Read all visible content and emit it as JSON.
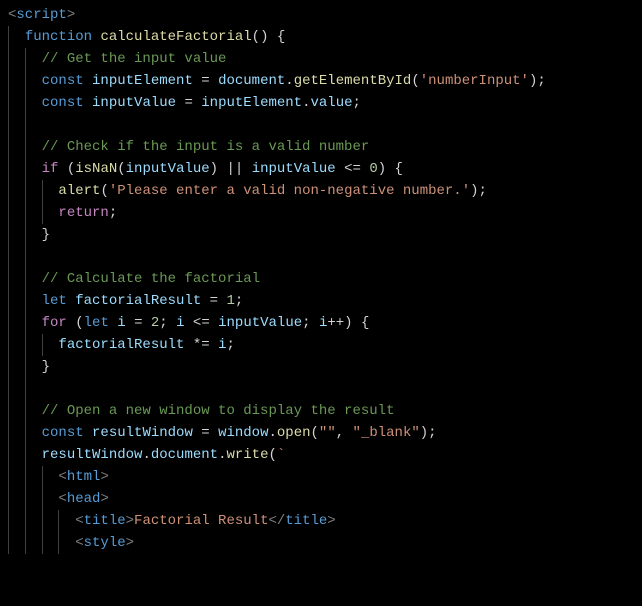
{
  "code": {
    "lines": [
      {
        "indent": 0,
        "guides": 0,
        "tokens": [
          {
            "c": "tag",
            "t": "<"
          },
          {
            "c": "elem",
            "t": "script"
          },
          {
            "c": "tag",
            "t": ">"
          }
        ]
      },
      {
        "indent": 1,
        "guides": 1,
        "tokens": [
          {
            "c": "kw",
            "t": "function"
          },
          {
            "c": "pun",
            "t": " "
          },
          {
            "c": "fn",
            "t": "calculateFactorial"
          },
          {
            "c": "pun",
            "t": "() {"
          }
        ]
      },
      {
        "indent": 2,
        "guides": 2,
        "tokens": [
          {
            "c": "cmt",
            "t": "// Get the input value"
          }
        ]
      },
      {
        "indent": 2,
        "guides": 2,
        "tokens": [
          {
            "c": "kw",
            "t": "const"
          },
          {
            "c": "pun",
            "t": " "
          },
          {
            "c": "var",
            "t": "inputElement"
          },
          {
            "c": "pun",
            "t": " = "
          },
          {
            "c": "var",
            "t": "document"
          },
          {
            "c": "pun",
            "t": "."
          },
          {
            "c": "fn",
            "t": "getElementById"
          },
          {
            "c": "pun",
            "t": "("
          },
          {
            "c": "str",
            "t": "'numberInput'"
          },
          {
            "c": "pun",
            "t": ");"
          }
        ]
      },
      {
        "indent": 2,
        "guides": 2,
        "tokens": [
          {
            "c": "kw",
            "t": "const"
          },
          {
            "c": "pun",
            "t": " "
          },
          {
            "c": "var",
            "t": "inputValue"
          },
          {
            "c": "pun",
            "t": " = "
          },
          {
            "c": "var",
            "t": "inputElement"
          },
          {
            "c": "pun",
            "t": "."
          },
          {
            "c": "var",
            "t": "value"
          },
          {
            "c": "pun",
            "t": ";"
          }
        ]
      },
      {
        "indent": 0,
        "guides": 2,
        "tokens": []
      },
      {
        "indent": 2,
        "guides": 2,
        "tokens": [
          {
            "c": "cmt",
            "t": "// Check if the input is a valid number"
          }
        ]
      },
      {
        "indent": 2,
        "guides": 2,
        "tokens": [
          {
            "c": "ctrl",
            "t": "if"
          },
          {
            "c": "pun",
            "t": " ("
          },
          {
            "c": "fn",
            "t": "isNaN"
          },
          {
            "c": "pun",
            "t": "("
          },
          {
            "c": "var",
            "t": "inputValue"
          },
          {
            "c": "pun",
            "t": ") || "
          },
          {
            "c": "var",
            "t": "inputValue"
          },
          {
            "c": "pun",
            "t": " <= "
          },
          {
            "c": "num",
            "t": "0"
          },
          {
            "c": "pun",
            "t": ") {"
          }
        ]
      },
      {
        "indent": 3,
        "guides": 3,
        "tokens": [
          {
            "c": "fn",
            "t": "alert"
          },
          {
            "c": "pun",
            "t": "("
          },
          {
            "c": "str",
            "t": "'Please enter a valid non-negative number.'"
          },
          {
            "c": "pun",
            "t": ");"
          }
        ]
      },
      {
        "indent": 3,
        "guides": 3,
        "tokens": [
          {
            "c": "ctrl",
            "t": "return"
          },
          {
            "c": "pun",
            "t": ";"
          }
        ]
      },
      {
        "indent": 2,
        "guides": 2,
        "tokens": [
          {
            "c": "pun",
            "t": "}"
          }
        ]
      },
      {
        "indent": 0,
        "guides": 2,
        "tokens": []
      },
      {
        "indent": 2,
        "guides": 2,
        "tokens": [
          {
            "c": "cmt",
            "t": "// Calculate the factorial"
          }
        ]
      },
      {
        "indent": 2,
        "guides": 2,
        "tokens": [
          {
            "c": "kw",
            "t": "let"
          },
          {
            "c": "pun",
            "t": " "
          },
          {
            "c": "var",
            "t": "factorialResult"
          },
          {
            "c": "pun",
            "t": " = "
          },
          {
            "c": "num",
            "t": "1"
          },
          {
            "c": "pun",
            "t": ";"
          }
        ]
      },
      {
        "indent": 2,
        "guides": 2,
        "tokens": [
          {
            "c": "ctrl",
            "t": "for"
          },
          {
            "c": "pun",
            "t": " ("
          },
          {
            "c": "kw",
            "t": "let"
          },
          {
            "c": "pun",
            "t": " "
          },
          {
            "c": "var",
            "t": "i"
          },
          {
            "c": "pun",
            "t": " = "
          },
          {
            "c": "num",
            "t": "2"
          },
          {
            "c": "pun",
            "t": "; "
          },
          {
            "c": "var",
            "t": "i"
          },
          {
            "c": "pun",
            "t": " <= "
          },
          {
            "c": "var",
            "t": "inputValue"
          },
          {
            "c": "pun",
            "t": "; "
          },
          {
            "c": "var",
            "t": "i"
          },
          {
            "c": "pun",
            "t": "++) {"
          }
        ]
      },
      {
        "indent": 3,
        "guides": 3,
        "tokens": [
          {
            "c": "var",
            "t": "factorialResult"
          },
          {
            "c": "pun",
            "t": " *= "
          },
          {
            "c": "var",
            "t": "i"
          },
          {
            "c": "pun",
            "t": ";"
          }
        ]
      },
      {
        "indent": 2,
        "guides": 2,
        "tokens": [
          {
            "c": "pun",
            "t": "}"
          }
        ]
      },
      {
        "indent": 0,
        "guides": 2,
        "tokens": []
      },
      {
        "indent": 2,
        "guides": 2,
        "tokens": [
          {
            "c": "cmt",
            "t": "// Open a new window to display the result"
          }
        ]
      },
      {
        "indent": 2,
        "guides": 2,
        "tokens": [
          {
            "c": "kw",
            "t": "const"
          },
          {
            "c": "pun",
            "t": " "
          },
          {
            "c": "var",
            "t": "resultWindow"
          },
          {
            "c": "pun",
            "t": " = "
          },
          {
            "c": "var",
            "t": "window"
          },
          {
            "c": "pun",
            "t": "."
          },
          {
            "c": "fn",
            "t": "open"
          },
          {
            "c": "pun",
            "t": "("
          },
          {
            "c": "str",
            "t": "\"\""
          },
          {
            "c": "pun",
            "t": ", "
          },
          {
            "c": "str",
            "t": "\"_blank\""
          },
          {
            "c": "pun",
            "t": ");"
          }
        ]
      },
      {
        "indent": 2,
        "guides": 2,
        "tokens": [
          {
            "c": "var",
            "t": "resultWindow"
          },
          {
            "c": "pun",
            "t": "."
          },
          {
            "c": "var",
            "t": "document"
          },
          {
            "c": "pun",
            "t": "."
          },
          {
            "c": "fn",
            "t": "write"
          },
          {
            "c": "pun",
            "t": "("
          },
          {
            "c": "str",
            "t": "`"
          }
        ]
      },
      {
        "indent": 3,
        "guides": 3,
        "tokens": [
          {
            "c": "tag",
            "t": "<"
          },
          {
            "c": "elem",
            "t": "html"
          },
          {
            "c": "tag",
            "t": ">"
          }
        ]
      },
      {
        "indent": 3,
        "guides": 3,
        "tokens": [
          {
            "c": "tag",
            "t": "<"
          },
          {
            "c": "elem",
            "t": "head"
          },
          {
            "c": "tag",
            "t": ">"
          }
        ]
      },
      {
        "indent": 4,
        "guides": 4,
        "tokens": [
          {
            "c": "tag",
            "t": "<"
          },
          {
            "c": "elem",
            "t": "title"
          },
          {
            "c": "tag",
            "t": ">"
          },
          {
            "c": "str",
            "t": "Factorial Result"
          },
          {
            "c": "tag",
            "t": "</"
          },
          {
            "c": "elem",
            "t": "title"
          },
          {
            "c": "tag",
            "t": ">"
          }
        ]
      },
      {
        "indent": 4,
        "guides": 4,
        "tokens": [
          {
            "c": "tag",
            "t": "<"
          },
          {
            "c": "elem",
            "t": "style"
          },
          {
            "c": "tag",
            "t": ">"
          }
        ]
      }
    ]
  },
  "indent_unit": "  "
}
